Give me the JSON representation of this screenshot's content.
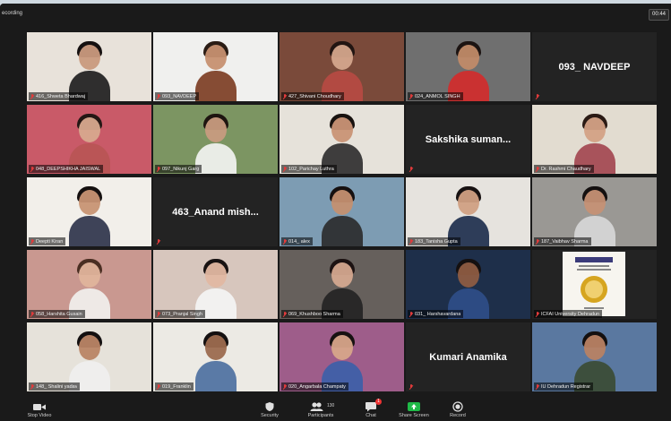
{
  "window": {
    "recording_label": "ecording",
    "timer": "00:44"
  },
  "participants": [
    {
      "label": "416_Shweta Bhardwaj",
      "type": "video",
      "skin": "#c99a7e",
      "hair": "#151010",
      "shirt": "#1b1b1b",
      "bg": "#e8e2da"
    },
    {
      "label": "093_NAVDEEP",
      "type": "video",
      "skin": "#c69070",
      "hair": "#2a1c14",
      "shirt": "#7a3a1f",
      "bg": "#f0f0ee"
    },
    {
      "label": "427_Shivani Choudhary",
      "type": "video",
      "skin": "#d4a58c",
      "hair": "#221512",
      "shirt": "#b84a44",
      "bg": "#7a4a3a"
    },
    {
      "label": "024_ANMOL SINGH",
      "type": "video",
      "skin": "#c08a68",
      "hair": "#1c1412",
      "shirt": "#d42a2a",
      "bg": "#6f6f6f"
    },
    {
      "label": "",
      "type": "name",
      "display": "093_ NAVDEEP"
    },
    {
      "label": "048_DEEPSHIKHA JAISWAL",
      "type": "video",
      "skin": "#d8a98e",
      "hair": "#241714",
      "shirt": "#b85454",
      "bg": "#c95a68"
    },
    {
      "label": "097_Nikunj Garg",
      "type": "video",
      "skin": "#c89b80",
      "hair": "#1e1510",
      "shirt": "#f5f5f5",
      "bg": "#7c9562"
    },
    {
      "label": "102_Parichay Luthra",
      "type": "video",
      "skin": "#c99476",
      "hair": "#18120f",
      "shirt": "#2b2b2b",
      "bg": "#e6e2da"
    },
    {
      "label": "",
      "type": "name",
      "display": "Sakshika suman..."
    },
    {
      "label": "Dr. Rashmi Chaudhary",
      "type": "video",
      "skin": "#d3a185",
      "hair": "#2a1a14",
      "shirt": "#a2444e",
      "bg": "#e2dcd0",
      "active": true
    },
    {
      "label": "Deepti Kiran",
      "type": "video",
      "skin": "#c79374",
      "hair": "#151010",
      "shirt": "#2a3048",
      "bg": "#f2efea"
    },
    {
      "label": "",
      "type": "name",
      "display": "463_Anand mish..."
    },
    {
      "label": "014_ alex",
      "type": "video",
      "skin": "#c49071",
      "hair": "#161010",
      "shirt": "#2a2a2a",
      "bg": "#7d9cb3"
    },
    {
      "label": "183_Tanisha Gupta",
      "type": "video",
      "skin": "#d0a083",
      "hair": "#171111",
      "shirt": "#1a2a4a",
      "bg": "#e6e3de"
    },
    {
      "label": "187_Vaibhav Sharma",
      "type": "video",
      "skin": "#c59175",
      "hair": "#141010",
      "shirt": "#d8d8d8",
      "bg": "#9a9894"
    },
    {
      "label": "058_Harshita Gusain",
      "type": "video",
      "skin": "#e0b49c",
      "hair": "#4a2e22",
      "shirt": "#f2f2f0",
      "bg": "#c99890"
    },
    {
      "label": "073_Pranjal Singh",
      "type": "video",
      "skin": "#e1b8a2",
      "hair": "#181212",
      "shirt": "#f5f5f5",
      "bg": "#d7c6bd"
    },
    {
      "label": "069_Khushboo Sharma",
      "type": "video",
      "skin": "#d4a88f",
      "hair": "#1c1212",
      "shirt": "#222222",
      "bg": "#66605c"
    },
    {
      "label": "031_ Harshavardana",
      "type": "video",
      "skin": "#8d5c42",
      "hair": "#141010",
      "shirt": "#2f4f8a",
      "bg": "#1e2f4a"
    },
    {
      "label": "ICFAI University Dehradun",
      "type": "logo",
      "bg": "#f7f5ef"
    },
    {
      "label": "148_ Shalini yadav",
      "type": "video",
      "skin": "#b98566",
      "hair": "#141010",
      "shirt": "#f0f0ee",
      "bg": "#e6e2da"
    },
    {
      "label": "019_Franklin",
      "type": "video",
      "skin": "#9c6b4f",
      "hair": "#141010",
      "shirt": "#4a6e9e",
      "bg": "#eceae4"
    },
    {
      "label": "020_Angarbala Champaty",
      "type": "video",
      "skin": "#d7a58a",
      "hair": "#171111",
      "shirt": "#3a5fa8",
      "bg": "#9e5d8a"
    },
    {
      "label": "",
      "type": "name",
      "display": "Kumari Anamika"
    },
    {
      "label": "IU Dehradun Registrar",
      "type": "video",
      "skin": "#b88264",
      "hair": "#141010",
      "shirt": "#3a4a32",
      "bg": "#5a78a0"
    }
  ],
  "toolbar": {
    "stop_video": "Stop Video",
    "security": "Security",
    "participants": "Participants",
    "participants_count": "130",
    "chat": "Chat",
    "chat_badge": "1",
    "share_screen": "Share Screen",
    "record": "Record"
  },
  "colors": {
    "app_bg": "#1a1a1a",
    "tile_bg": "#232323",
    "active_speaker": "#f3d55b",
    "muted_icon": "#e23b3b",
    "share_green": "#1fba47"
  }
}
